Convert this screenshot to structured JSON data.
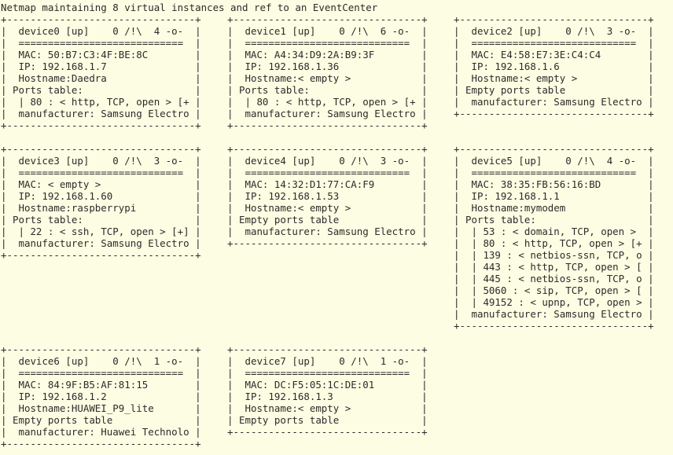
{
  "header": "Netmap maintaining 8 virtual instances and ref to an EventCenter",
  "cards": [
    {
      "lines": [
        "+--------------------------------+",
        "|  device0 [up]    0 /!\\  4 -o-  |",
        "|  ============================  |",
        "|  MAC: 50:B7:C3:4F:BE:8C        |",
        "|  IP: 192.168.1.7               |",
        "|  Hostname:Daedra               |",
        "| Ports table:                   |",
        "|  | 80 : < http, TCP, open > [+ |",
        "|  manufacturer: Samsung Electro |",
        "+--------------------------------+"
      ]
    },
    {
      "lines": [
        "+--------------------------------+",
        "|  device1 [up]    0 /!\\  6 -o-  |",
        "|  ============================  |",
        "|  MAC: A4:34:D9:2A:B9:3F        |",
        "|  IP: 192.168.1.36              |",
        "|  Hostname:< empty >            |",
        "| Ports table:                   |",
        "|  | 80 : < http, TCP, open > [+ |",
        "|  manufacturer: Samsung Electro |",
        "+--------------------------------+"
      ]
    },
    {
      "lines": [
        "+--------------------------------+",
        "|  device2 [up]    0 /!\\  3 -o-  |",
        "|  ============================  |",
        "|  MAC: E4:58:E7:3E:C4:C4        |",
        "|  IP: 192.168.1.6               |",
        "|  Hostname:< empty >            |",
        "| Empty ports table              |",
        "|  manufacturer: Samsung Electro |",
        "+--------------------------------+"
      ]
    },
    {
      "lines": [
        "+--------------------------------+",
        "|  device3 [up]    0 /!\\  3 -o-  |",
        "|  ============================  |",
        "|  MAC: < empty >                |",
        "|  IP: 192.168.1.60              |",
        "|  Hostname:raspberrypi          |",
        "| Ports table:                   |",
        "|  | 22 : < ssh, TCP, open > [+] |",
        "|  manufacturer: Samsung Electro |",
        "+--------------------------------+"
      ]
    },
    {
      "lines": [
        "+--------------------------------+",
        "|  device4 [up]    0 /!\\  3 -o-  |",
        "|  ============================  |",
        "|  MAC: 14:32:D1:77:CA:F9        |",
        "|  IP: 192.168.1.53              |",
        "|  Hostname:< empty >            |",
        "| Empty ports table              |",
        "|  manufacturer: Samsung Electro |",
        "+--------------------------------+"
      ]
    },
    {
      "lines": [
        "+--------------------------------+",
        "|  device5 [up]    0 /!\\  4 -o-  |",
        "|  ============================  |",
        "|  MAC: 38:35:FB:56:16:BD        |",
        "|  IP: 192.168.1.1               |",
        "|  Hostname:mymodem              |",
        "| Ports table:                   |",
        "|  | 53 : < domain, TCP, open >  |",
        "|  | 80 : < http, TCP, open > [+ |",
        "|  | 139 : < netbios-ssn, TCP, o |",
        "|  | 443 : < http, TCP, open > [ |",
        "|  | 445 : < netbios-ssn, TCP, o |",
        "|  | 5060 : < sip, TCP, open > [ |",
        "|  | 49152 : < upnp, TCP, open > |",
        "|  manufacturer: Samsung Electro |",
        "+--------------------------------+"
      ]
    },
    {
      "lines": [
        "+--------------------------------+",
        "|  device6 [up]    0 /!\\  1 -o-  |",
        "|  ============================  |",
        "|  MAC: 84:9F:B5:AF:81:15        |",
        "|  IP: 192.168.1.2               |",
        "|  Hostname:HUAWEI_P9_lite       |",
        "| Empty ports table              |",
        "|  manufacturer: Huawei Technolo |",
        "+--------------------------------+"
      ]
    },
    {
      "lines": [
        "+--------------------------------+",
        "|  device7 [up]    0 /!\\  1 -o-  |",
        "|  ============================  |",
        "|  MAC: DC:F5:05:1C:DE:01        |",
        "|  IP: 192.168.1.3               |",
        "|  Hostname:< empty >            |",
        "| Empty ports table              |",
        "+--------------------------------+"
      ]
    }
  ]
}
